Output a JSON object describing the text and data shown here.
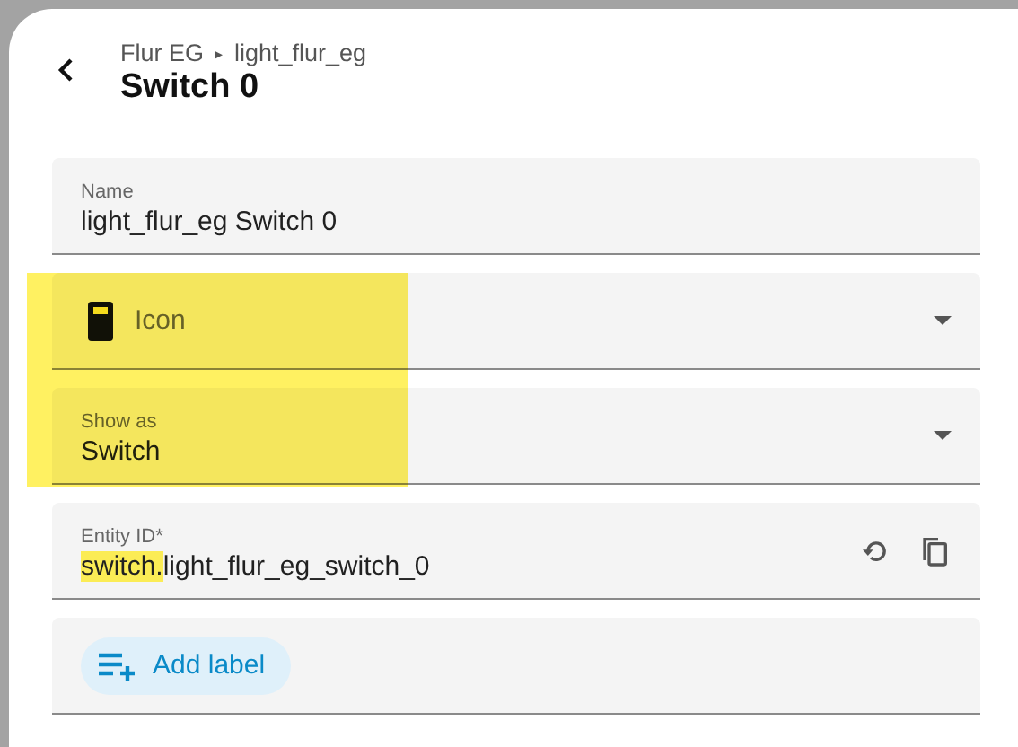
{
  "dialog": {
    "breadcrumb": {
      "area": "Flur EG",
      "separator": "▸",
      "device": "light_flur_eg"
    },
    "title": "Switch 0"
  },
  "fields": [
    {
      "kind": "text",
      "label": "Name",
      "value": "light_flur_eg Switch 0",
      "highlighted": false
    },
    {
      "kind": "icon-picker",
      "placeholder": "Icon",
      "highlighted": true
    },
    {
      "kind": "select",
      "label": "Show as",
      "value": "Switch",
      "highlighted": true
    },
    {
      "kind": "entity-id",
      "label": "Entity ID*",
      "value_prefix": "switch.",
      "prefix_highlighted": true,
      "value": "light_flur_eg_switch_0",
      "highlighted": false
    },
    {
      "kind": "labels",
      "button": "Add label",
      "highlighted": false
    }
  ]
}
